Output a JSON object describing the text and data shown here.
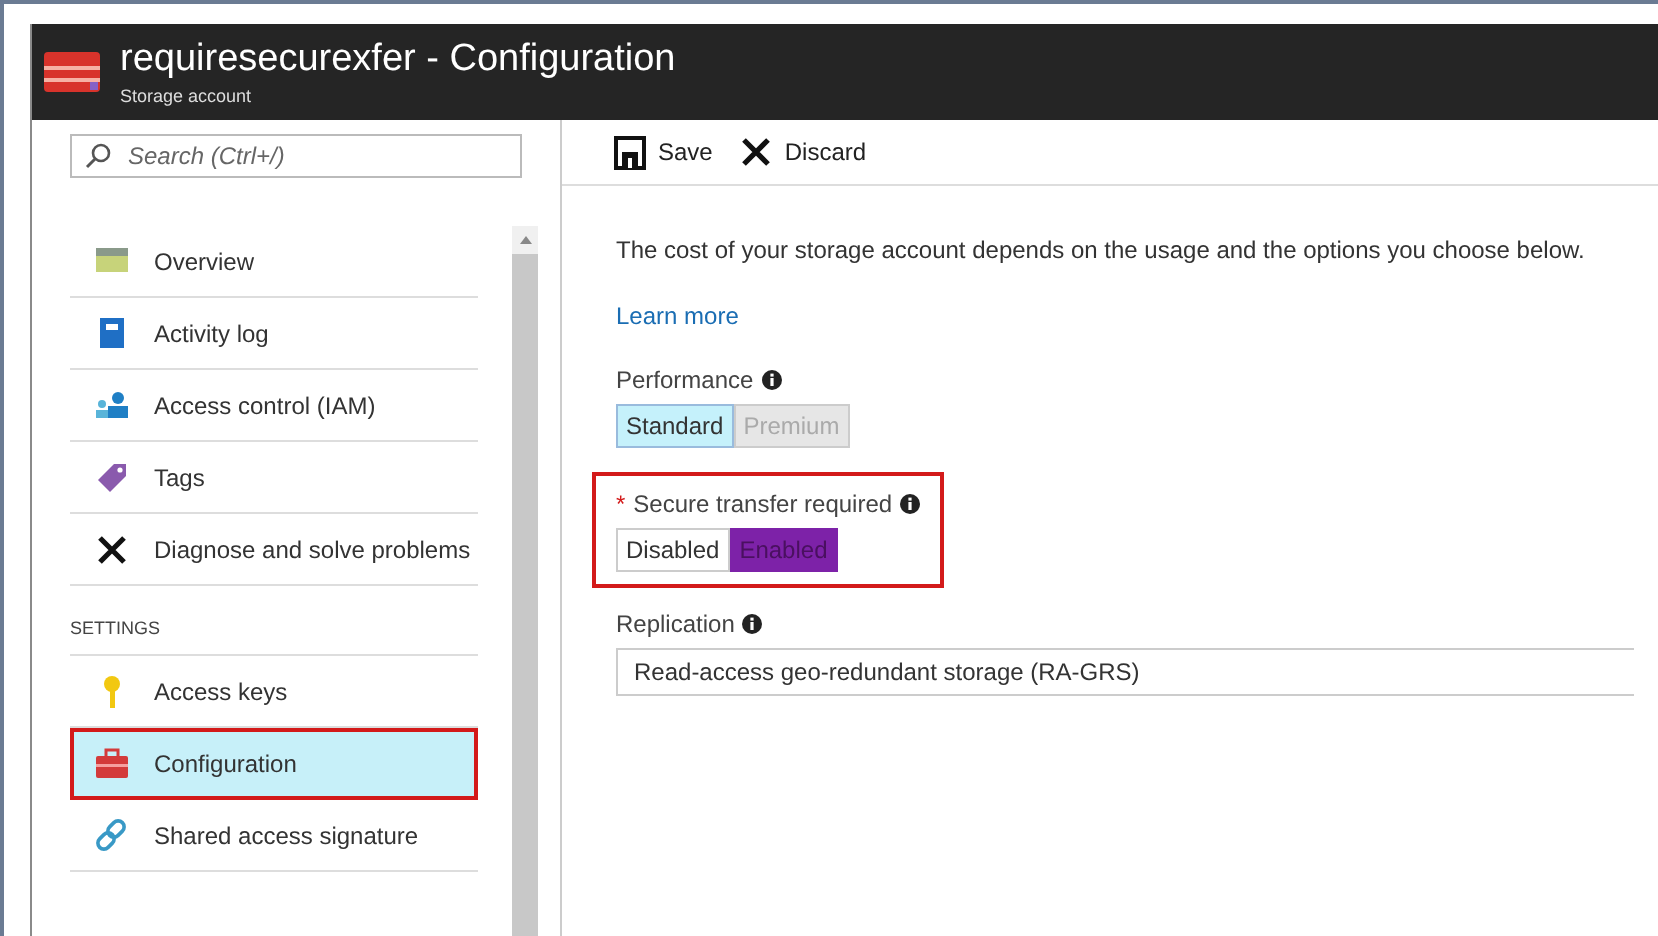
{
  "window": {
    "title": "requiresecurexfer - Configuration",
    "subtitle": "Storage account"
  },
  "sidebar": {
    "search": {
      "placeholder": "Search (Ctrl+/)"
    },
    "sections": [
      {
        "items": [
          {
            "label": "Overview",
            "selected": false,
            "highlighted": false
          },
          {
            "label": "Activity log",
            "selected": false,
            "highlighted": false
          },
          {
            "label": "Access control (IAM)",
            "selected": false,
            "highlighted": false
          },
          {
            "label": "Tags",
            "selected": false,
            "highlighted": false
          },
          {
            "label": "Diagnose and solve problems",
            "selected": false,
            "highlighted": false
          }
        ]
      },
      {
        "heading": "SETTINGS",
        "items": [
          {
            "label": "Access keys",
            "selected": false,
            "highlighted": false
          },
          {
            "label": "Configuration",
            "selected": true,
            "highlighted": true
          },
          {
            "label": "Shared access signature",
            "selected": false,
            "highlighted": false
          }
        ]
      }
    ]
  },
  "toolbar": [
    {
      "label": "Save"
    },
    {
      "label": "Discard"
    }
  ],
  "content": {
    "description": "The cost of your storage account depends on the usage and the options you choose below.",
    "link": "Learn more",
    "settings": [
      {
        "kind": "toggle",
        "label": "Performance",
        "highlighted": false,
        "options": [
          {
            "label": "Standard",
            "selected": true,
            "disabled": false
          },
          {
            "label": "Premium",
            "selected": false,
            "disabled": true
          }
        ]
      },
      {
        "kind": "toggle",
        "label": "Secure transfer required",
        "required_mark": "*",
        "highlighted": true,
        "options": [
          {
            "label": "Disabled",
            "selected": false,
            "disabled": false
          },
          {
            "label": "Enabled",
            "selected": true,
            "disabled": false
          }
        ]
      },
      {
        "kind": "dropdown",
        "label": "Replication",
        "highlighted": false,
        "value": "Read-access geo-redundant storage (RA-GRS)"
      }
    ]
  }
}
